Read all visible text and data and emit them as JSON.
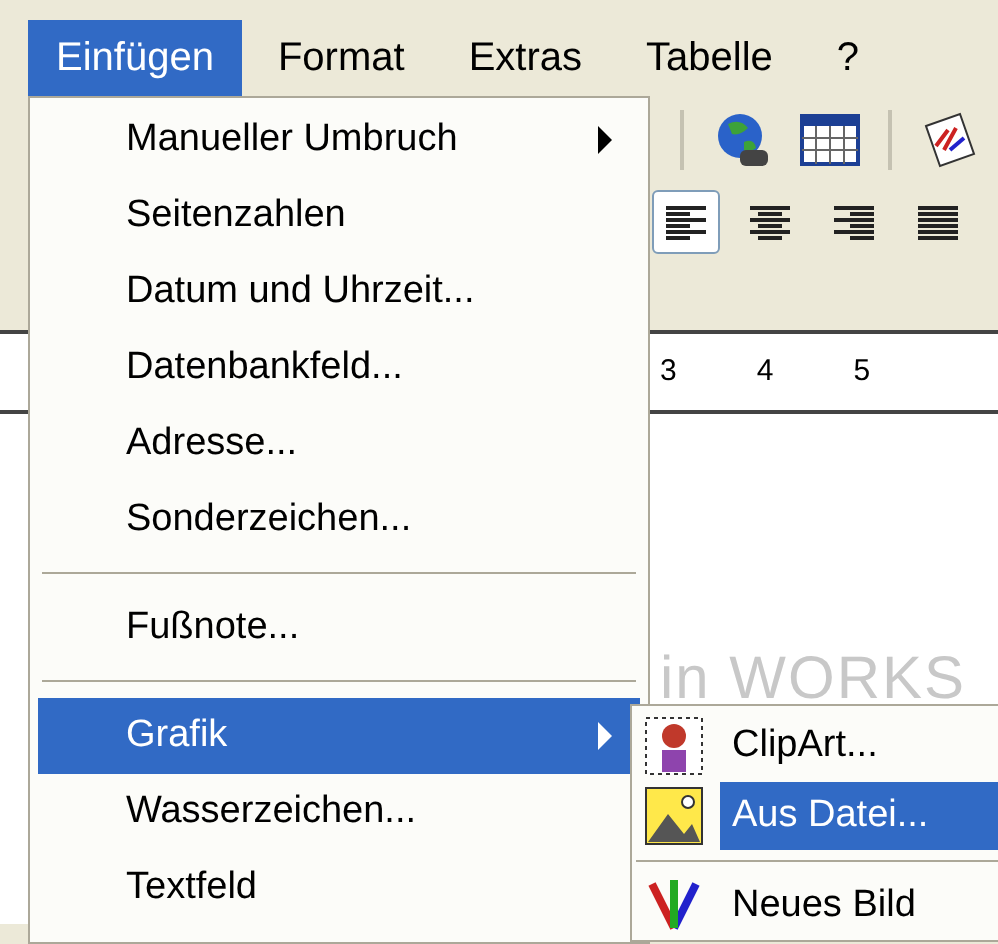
{
  "menubar": [
    {
      "label": "Einfügen",
      "selected": true
    },
    {
      "label": "Format",
      "selected": false
    },
    {
      "label": "Extras",
      "selected": false
    },
    {
      "label": "Tabelle",
      "selected": false
    },
    {
      "label": "?",
      "selected": false
    }
  ],
  "ruler": {
    "marks": [
      "3",
      "4",
      "5"
    ]
  },
  "document": {
    "text": "in WORKS"
  },
  "menu": {
    "items": [
      {
        "kind": "item",
        "label": "Manueller Umbruch",
        "submenu": true,
        "selected": false
      },
      {
        "kind": "item",
        "label": "Seitenzahlen",
        "submenu": false,
        "selected": false
      },
      {
        "kind": "item",
        "label": "Datum und Uhrzeit...",
        "submenu": false,
        "selected": false
      },
      {
        "kind": "item",
        "label": "Datenbankfeld...",
        "submenu": false,
        "selected": false
      },
      {
        "kind": "item",
        "label": "Adresse...",
        "submenu": false,
        "selected": false
      },
      {
        "kind": "item",
        "label": "Sonderzeichen...",
        "submenu": false,
        "selected": false
      },
      {
        "kind": "separator"
      },
      {
        "kind": "item",
        "label": "Fußnote...",
        "submenu": false,
        "selected": false
      },
      {
        "kind": "separator"
      },
      {
        "kind": "item",
        "label": "Grafik",
        "submenu": true,
        "selected": true
      },
      {
        "kind": "item",
        "label": "Wasserzeichen...",
        "submenu": false,
        "selected": false
      },
      {
        "kind": "item",
        "label": "Textfeld",
        "submenu": false,
        "selected": false
      }
    ]
  },
  "submenu": {
    "items": [
      {
        "kind": "item",
        "label": "ClipArt...",
        "selected": false
      },
      {
        "kind": "item",
        "label": "Aus Datei...",
        "selected": true
      },
      {
        "kind": "separator"
      },
      {
        "kind": "item",
        "label": "Neues Bild",
        "selected": false
      }
    ]
  }
}
